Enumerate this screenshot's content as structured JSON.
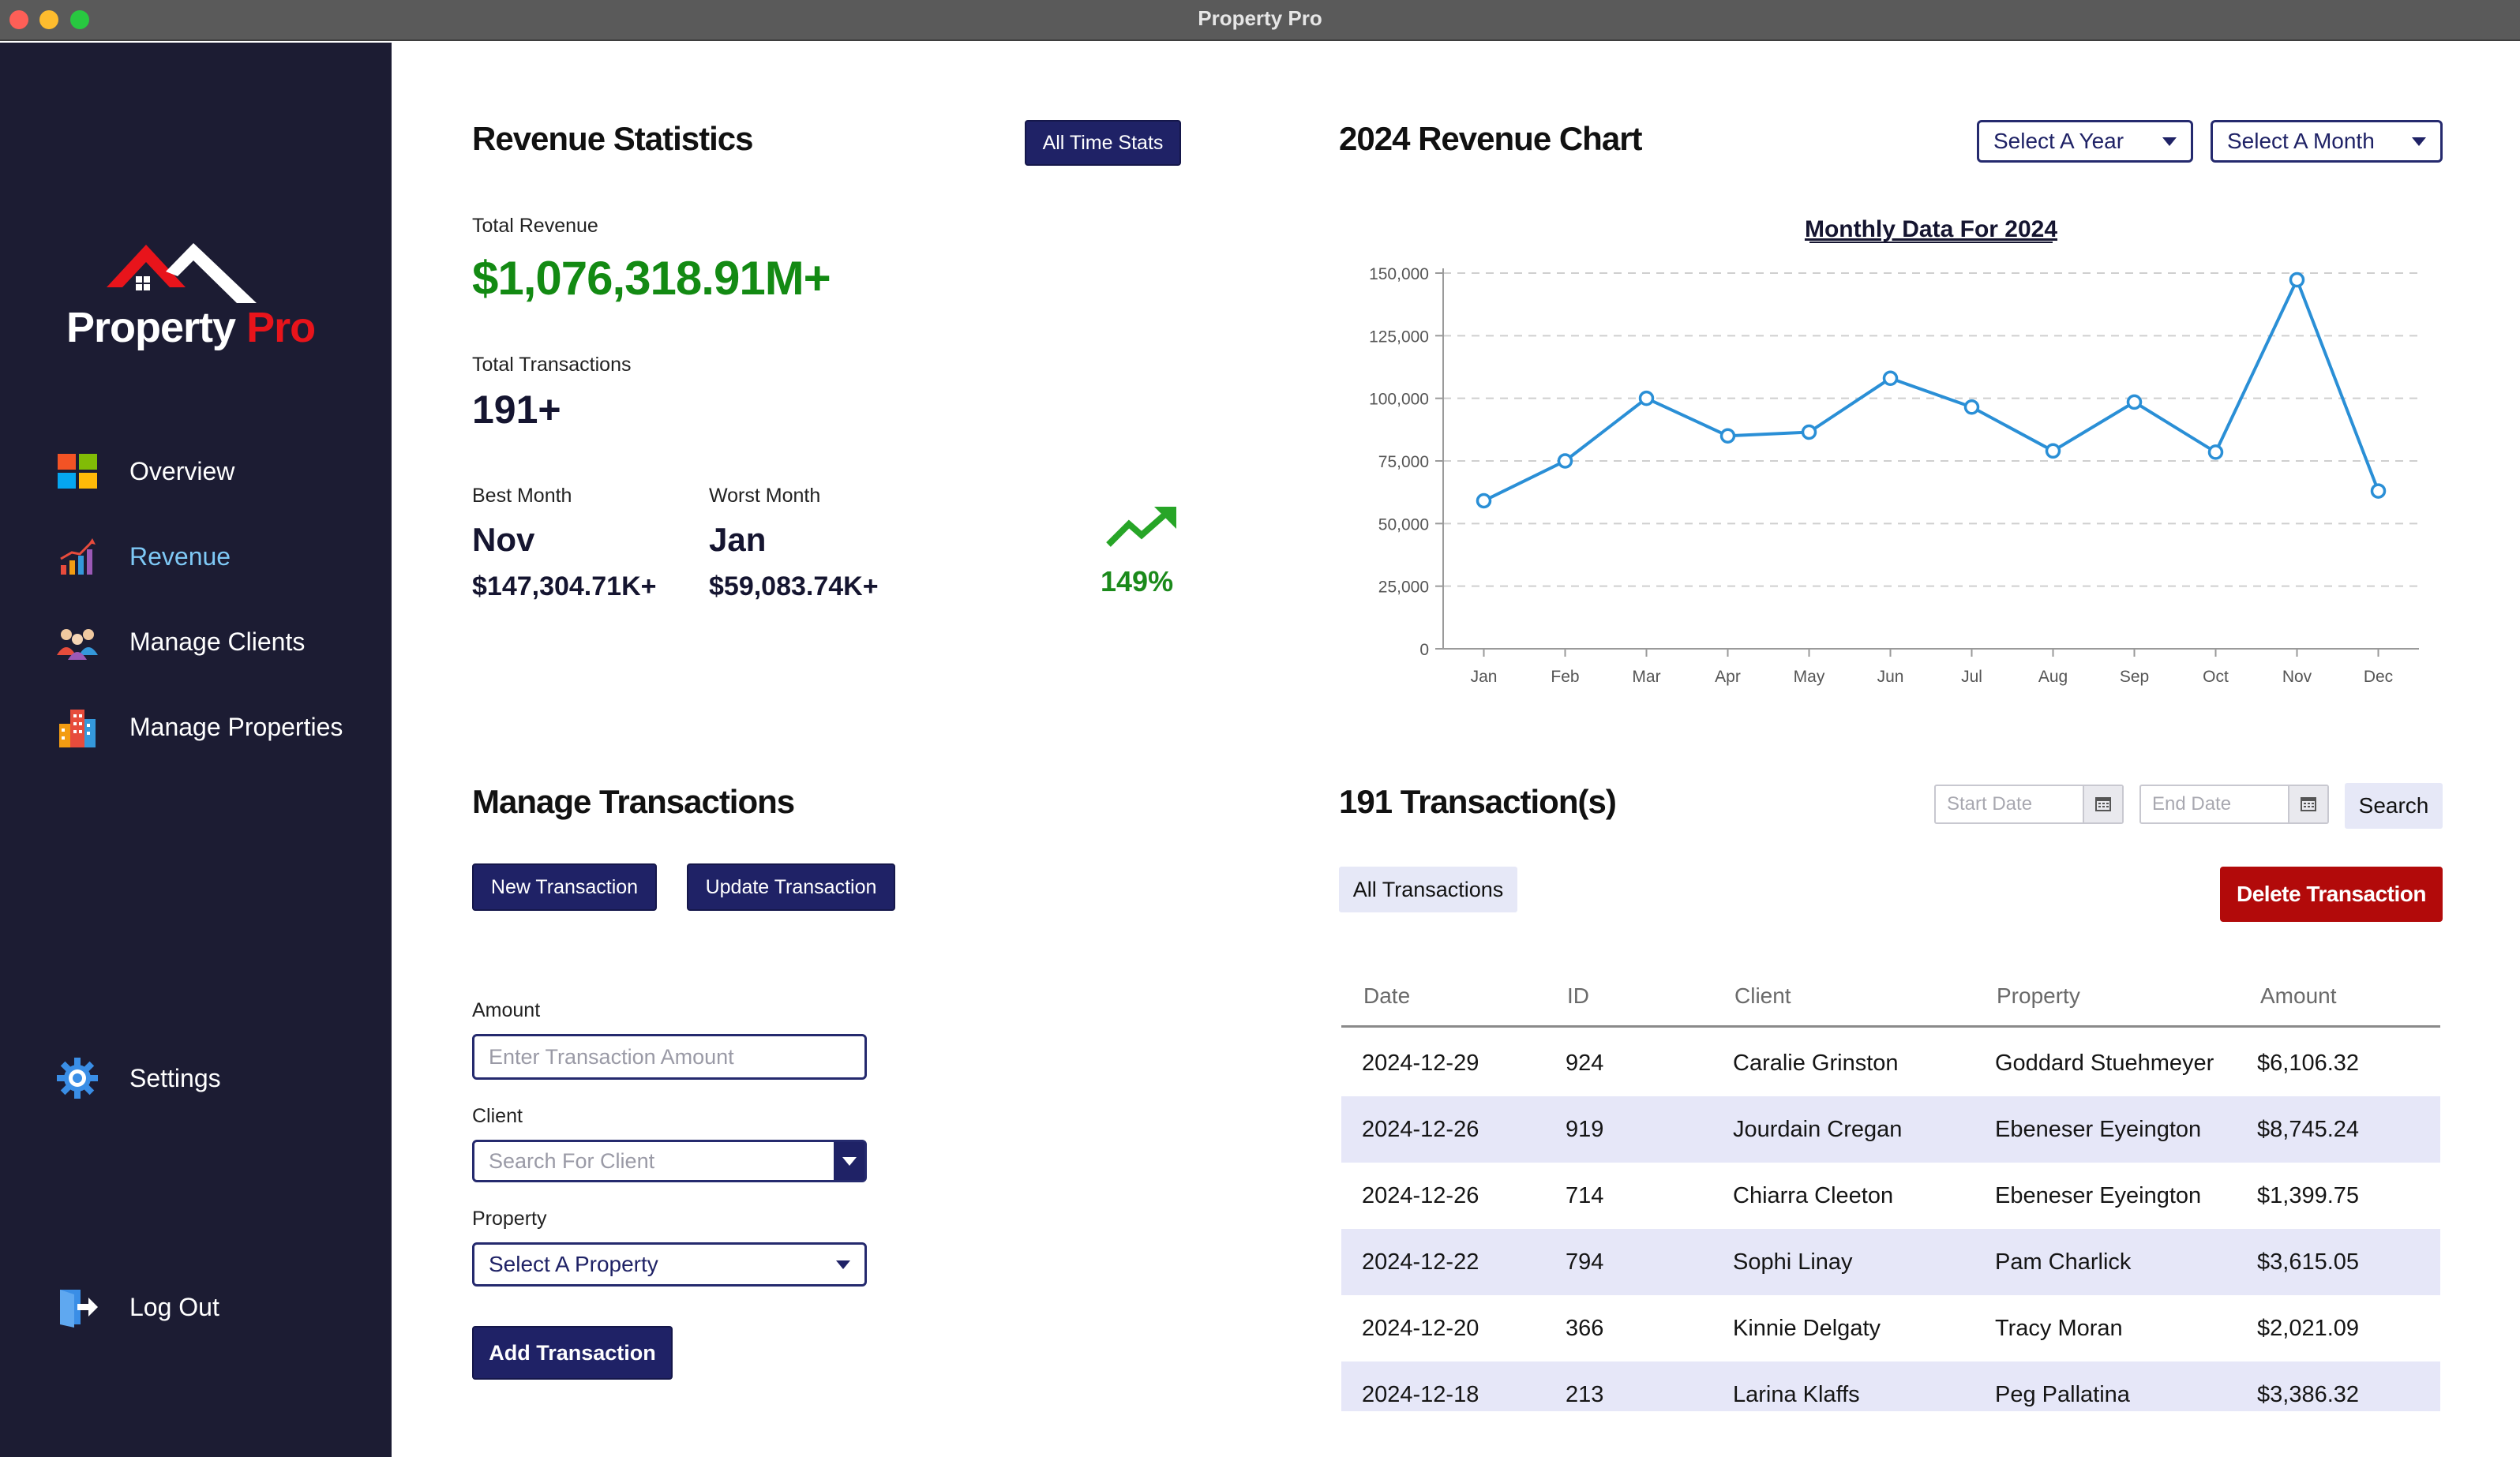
{
  "window": {
    "title": "Property Pro"
  },
  "sidebar": {
    "logo": {
      "part1": "Property",
      "part2": " Pro"
    },
    "items": [
      {
        "label": "Overview",
        "icon": "windows-grid-icon"
      },
      {
        "label": "Revenue",
        "icon": "bar-chart-icon"
      },
      {
        "label": "Manage Clients",
        "icon": "people-icon"
      },
      {
        "label": "Manage Properties",
        "icon": "buildings-icon"
      },
      {
        "label": "Settings",
        "icon": "gear-icon"
      },
      {
        "label": "Log Out",
        "icon": "logout-icon"
      }
    ],
    "active": "Revenue"
  },
  "stats": {
    "title": "Revenue Statistics",
    "all_time_button": "All Time Stats",
    "total_revenue_label": "Total Revenue",
    "total_revenue": "$1,076,318.91M+",
    "total_transactions_label": "Total Transactions",
    "total_transactions": "191+",
    "best_month_label": "Best Month",
    "best_month": "Nov",
    "best_month_value": "$147,304.71K+",
    "worst_month_label": "Worst Month",
    "worst_month": "Jan",
    "worst_month_value": "$59,083.74K+",
    "growth": "149%",
    "colors": {
      "green": "#138a13",
      "navy": "#1f2266"
    }
  },
  "chart_section": {
    "title": "2024 Revenue Chart",
    "year_select": "Select A Year",
    "month_select": "Select A Month"
  },
  "chart_data": {
    "type": "line",
    "title": "Monthly Data For 2024",
    "categories": [
      "Jan",
      "Feb",
      "Mar",
      "Apr",
      "May",
      "Jun",
      "Jul",
      "Aug",
      "Sep",
      "Oct",
      "Nov",
      "Dec"
    ],
    "values": [
      59084,
      75000,
      100000,
      85000,
      86500,
      108000,
      96500,
      79000,
      98500,
      78500,
      147305,
      63000
    ],
    "yticks": [
      "0",
      "25,000",
      "50,000",
      "75,000",
      "100,000",
      "125,000",
      "150,000"
    ],
    "ylim": [
      0,
      150000
    ],
    "grid": true,
    "color": "#2a8fd6"
  },
  "manage": {
    "title": "Manage Transactions",
    "new_button": "New Transaction",
    "update_button": "Update Transaction",
    "amount_label": "Amount",
    "amount_placeholder": "Enter Transaction Amount",
    "client_label": "Client",
    "client_placeholder": "Search For Client",
    "property_label": "Property",
    "property_select": "Select A Property",
    "add_button": "Add Transaction"
  },
  "transactions": {
    "title": "191 Transaction(s)",
    "start_placeholder": "Start Date",
    "end_placeholder": "End Date",
    "search_button": "Search",
    "all_button": "All Transactions",
    "delete_button": "Delete Transaction",
    "columns": [
      "Date",
      "ID",
      "Client",
      "Property",
      "Amount"
    ],
    "rows": [
      [
        "2024-12-29",
        "924",
        "Caralie Grinston",
        "Goddard Stuehmeyer",
        "$6,106.32"
      ],
      [
        "2024-12-26",
        "919",
        "Jourdain Cregan",
        "Ebeneser Eyeington",
        "$8,745.24"
      ],
      [
        "2024-12-26",
        "714",
        "Chiarra Cleeton",
        "Ebeneser Eyeington",
        "$1,399.75"
      ],
      [
        "2024-12-22",
        "794",
        "Sophi Linay",
        "Pam Charlick",
        "$3,615.05"
      ],
      [
        "2024-12-20",
        "366",
        "Kinnie Delgaty",
        "Tracy Moran",
        "$2,021.09"
      ],
      [
        "2024-12-18",
        "213",
        "Larina Klaffs",
        "Peg Pallatina",
        "$3,386.32"
      ]
    ]
  }
}
